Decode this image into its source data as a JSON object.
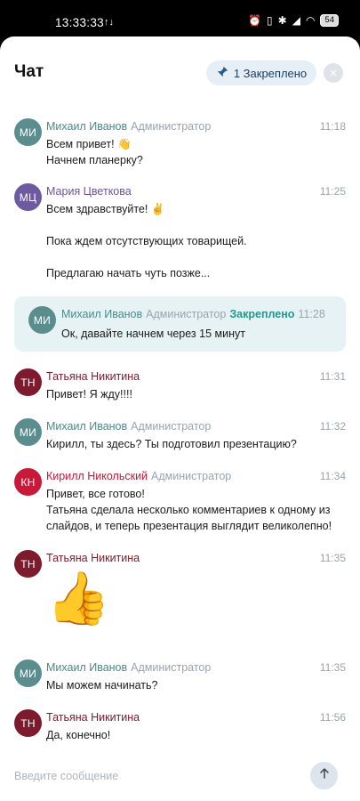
{
  "status_bar": {
    "time": "13:33:33",
    "battery": "54",
    "colors": {
      "bg": "#000000",
      "text": "#ffffff"
    }
  },
  "header": {
    "title": "Чат",
    "pinned_button_label": "1 Закреплено",
    "close_icon": "×",
    "pin_icon": "pin-icon"
  },
  "messages": [
    {
      "initials": "МИ",
      "name": "Михаил Иванов",
      "role": "Администратор",
      "time": "11:18",
      "lines": [
        "Всем привет! 👋",
        "Начнем планерку?"
      ],
      "color": "#5b8d8e",
      "name_color": "#4b8a86"
    },
    {
      "initials": "МЦ",
      "name": "Мария Цветкова",
      "role": "",
      "time": "11:25",
      "lines": [
        "Всем здравствуйте! ✌️",
        "",
        "Пока ждем отсутствующих товарищей.",
        "",
        "Предлагаю начать чуть позже..."
      ],
      "color": "#6d5aa0",
      "name_color": "#6a559c"
    },
    {
      "initials": "ТН",
      "name": "Татьяна Никитина",
      "role": "",
      "time": "11:31",
      "lines": [
        "Привет! Я жду!!!!"
      ],
      "color": "#7d1a2e",
      "name_color": "#7b1a2c"
    },
    {
      "initials": "МИ",
      "name": "Михаил Иванов",
      "role": "Администратор",
      "time": "11:32",
      "lines": [
        "Кирилл, ты здесь? Ты подготовил презентацию?"
      ],
      "color": "#5b8d8e",
      "name_color": "#4b8a86"
    },
    {
      "initials": "КН",
      "name": "Кирилл Никольский",
      "role": "Администратор",
      "time": "11:34",
      "lines": [
        "Привет, все готово!",
        "Татьяна сделала несколько комментариев к одному из",
        "слайдов, и теперь презентация выглядит великолепно!"
      ],
      "color": "#c8193a",
      "name_color": "#c01b3b"
    },
    {
      "initials": "ТН",
      "name": "Татьяна Никитина",
      "role": "",
      "time": "11:35",
      "lines": [],
      "emoji": "👍",
      "color": "#7d1a2e",
      "name_color": "#7b1a2c"
    },
    {
      "initials": "МИ",
      "name": "Михаил Иванов",
      "role": "Администратор",
      "time": "11:35",
      "lines": [
        "Мы можем начинать?"
      ],
      "color": "#5b8d8e",
      "name_color": "#4b8a86"
    },
    {
      "initials": "ТН",
      "name": "Татьяна Никитина",
      "role": "",
      "time": "11:56",
      "lines": [
        "Да, конечно!"
      ],
      "color": "#7d1a2e",
      "name_color": "#7b1a2c"
    }
  ],
  "pinned_message": {
    "initials": "МИ",
    "name": "Михаил Иванов",
    "role": "Администратор",
    "pinned_label": "Закреплено",
    "time": "11:28",
    "text": "Ок, давайте начнем через 15 минут",
    "color": "#5b8d8e",
    "name_color": "#4b8a86"
  },
  "composer": {
    "placeholder": "Введите сообщение",
    "send_icon": "arrow-up-icon"
  }
}
